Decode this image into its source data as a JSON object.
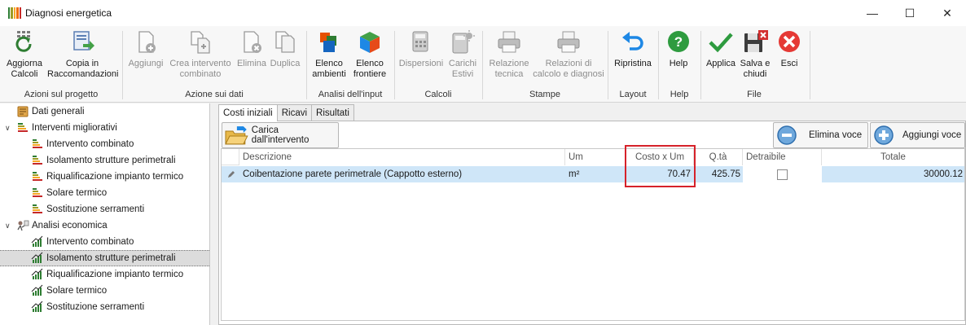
{
  "window": {
    "title": "Diagnosi energetica",
    "minimize_glyph": "—",
    "maximize_glyph": "☐",
    "close_glyph": "✕"
  },
  "ribbon": {
    "groups": {
      "progetto": "Azioni sul progetto",
      "dati": "Azione sui dati",
      "input": "Analisi dell'input",
      "calcoli": "Calcoli",
      "stampe": "Stampe",
      "layout": "Layout",
      "help": "Help",
      "file": "File"
    },
    "buttons": {
      "aggiorna": [
        "Aggiorna",
        "Calcoli"
      ],
      "copia": [
        "Copia in",
        "Raccomandazioni"
      ],
      "aggiungi": "Aggiungi",
      "crea": [
        "Crea intervento",
        "combinato"
      ],
      "elimina": "Elimina",
      "duplica": "Duplica",
      "elenco_ambienti": [
        "Elenco",
        "ambienti"
      ],
      "elenco_frontiere": [
        "Elenco",
        "frontiere"
      ],
      "dispersioni": "Dispersioni",
      "carichi": [
        "Carichi",
        "Estivi"
      ],
      "relazione": [
        "Relazione",
        "tecnica"
      ],
      "relazioni_calcolo": [
        "Relazioni di",
        "calcolo e diagnosi"
      ],
      "ripristina": "Ripristina",
      "help": "Help",
      "applica": "Applica",
      "salva": [
        "Salva e",
        "chiudi"
      ],
      "esci": "Esci"
    },
    "icons": {
      "aggiorna": "refresh-calc-icon",
      "copia": "copy-to-recommendations-icon",
      "aggiungi": "add-document-icon",
      "crea": "combined-intervention-icon",
      "elimina": "delete-document-icon",
      "duplica": "duplicate-icon",
      "elenco_ambienti": "rooms-list-icon",
      "elenco_frontiere": "boundaries-cube-icon",
      "dispersioni": "dispersion-calc-icon",
      "carichi": "summer-load-calc-icon",
      "relazione": "printer-icon",
      "relazioni_calcolo": "printer-icon",
      "ripristina": "undo-arrow-icon",
      "help": "help-icon",
      "applica": "checkmark-icon",
      "salva": "save-close-icon",
      "esci": "exit-icon"
    }
  },
  "tree": {
    "items": [
      {
        "label": "Dati generali",
        "level": 0,
        "expandable": false,
        "icon": "general-data-icon"
      },
      {
        "label": "Interventi migliorativi",
        "level": 0,
        "expandable": true,
        "icon": "energy-class-icon"
      },
      {
        "label": "Intervento combinato",
        "level": 1,
        "icon": "energy-class-icon"
      },
      {
        "label": "Isolamento strutture perimetrali",
        "level": 1,
        "icon": "energy-class-icon"
      },
      {
        "label": "Riqualificazione impianto termico",
        "level": 1,
        "icon": "energy-class-icon"
      },
      {
        "label": "Solare termico",
        "level": 1,
        "icon": "energy-class-icon"
      },
      {
        "label": "Sostituzione serramenti",
        "level": 1,
        "icon": "energy-class-icon"
      },
      {
        "label": "Analisi economica",
        "level": 0,
        "expandable": true,
        "icon": "economic-analysis-icon"
      },
      {
        "label": "Intervento combinato",
        "level": 1,
        "icon": "bar-trend-icon"
      },
      {
        "label": "Isolamento strutture perimetrali",
        "level": 1,
        "icon": "bar-trend-icon",
        "selected": true
      },
      {
        "label": "Riqualificazione impianto termico",
        "level": 1,
        "icon": "bar-trend-icon"
      },
      {
        "label": "Solare termico",
        "level": 1,
        "icon": "bar-trend-icon"
      },
      {
        "label": "Sostituzione serramenti",
        "level": 1,
        "icon": "bar-trend-icon"
      }
    ]
  },
  "tabs": [
    "Costi iniziali",
    "Ricavi",
    "Risultati"
  ],
  "toolbar": {
    "carica": "Carica dall'intervento",
    "elimina_voce": "Elimina voce",
    "aggiungi_voce": "Aggiungi voce"
  },
  "grid": {
    "columns": [
      "Descrizione",
      "Um",
      "Costo x Um",
      "Q.tà",
      "Detraibile",
      "Totale"
    ],
    "rows": [
      {
        "descrizione": "Coibentazione parete perimetrale (Cappotto esterno)",
        "um": "m²",
        "costo": "70.47",
        "qta": "425.75",
        "detraibile": false,
        "totale": "30000.12"
      }
    ]
  },
  "colors": {
    "highlight": "#d6222a",
    "row_selected": "#cfe6f8",
    "tree_selected": "#dcdcdc"
  }
}
